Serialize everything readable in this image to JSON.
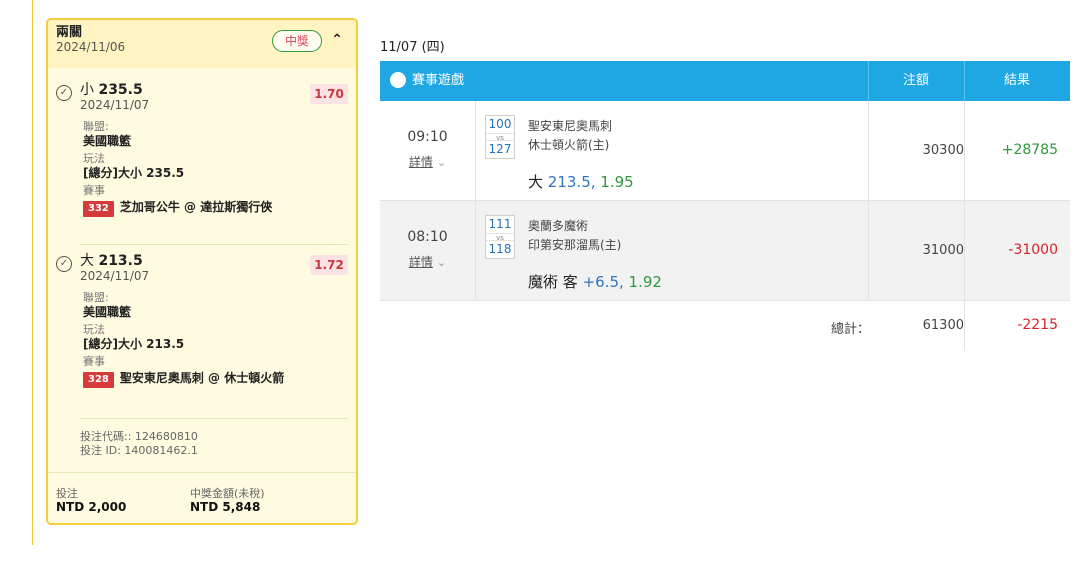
{
  "slip": {
    "title": "兩關",
    "date": "2024/11/06",
    "status": "中獎",
    "collapse_icon": "chevron-up",
    "legs": [
      {
        "pick_prefix": "小",
        "pick_value": "235.5",
        "date": "2024/11/07",
        "odds": "1.70",
        "league_label": "聯盟:",
        "league": "美國職籃",
        "play_label": "玩法",
        "play": "[總分]大小 235.5",
        "event_label": "賽事",
        "event_id": "332",
        "event": "芝加哥公牛 @ 達拉斯獨行俠"
      },
      {
        "pick_prefix": "大",
        "pick_value": "213.5",
        "date": "2024/11/07",
        "odds": "1.72",
        "league_label": "聯盟:",
        "league": "美國職籃",
        "play_label": "玩法",
        "play": "[總分]大小 213.5",
        "event_label": "賽事",
        "event_id": "328",
        "event": "聖安東尼奧馬刺 @ 休士頓火箭"
      }
    ],
    "bet_code": "投注代碼:: 124680810",
    "bet_id": "投注 ID: 140081462.1",
    "stake_label": "投注",
    "stake_value": "NTD 2,000",
    "payout_label": "中獎金額(未稅)",
    "payout_value": "NTD 5,848"
  },
  "results": {
    "day_title": "11/07 (四)",
    "headers": {
      "game": "賽事遊戲",
      "amount": "注額",
      "result": "結果"
    },
    "rows": [
      {
        "time": "09:10",
        "detail": "詳情",
        "num_top": "100",
        "num_bottom": "127",
        "vs": "vs",
        "team_top": "聖安東尼奧馬刺",
        "team_bottom": "休士頓火箭(主)",
        "pick_text": "大",
        "pick_line": "213.5,",
        "pick_odds": "1.95",
        "amount": "30300",
        "result": "+28785"
      },
      {
        "time": "08:10",
        "detail": "詳情",
        "num_top": "111",
        "num_bottom": "118",
        "vs": "vs",
        "team_top": "奧蘭多魔術",
        "team_bottom": "印第安那溜馬(主)",
        "pick_text": "魔術 客",
        "pick_line": "+6.5,",
        "pick_odds": "1.92",
        "amount": "31000",
        "result": "-31000"
      }
    ],
    "total_label": "總計：",
    "total_amount": "61300",
    "total_result": "-2215"
  },
  "colors": {
    "accent": "#1ea7e3",
    "positive": "#2e9a3a",
    "negative": "#d8232a",
    "card_border": "#f3cd3a"
  }
}
